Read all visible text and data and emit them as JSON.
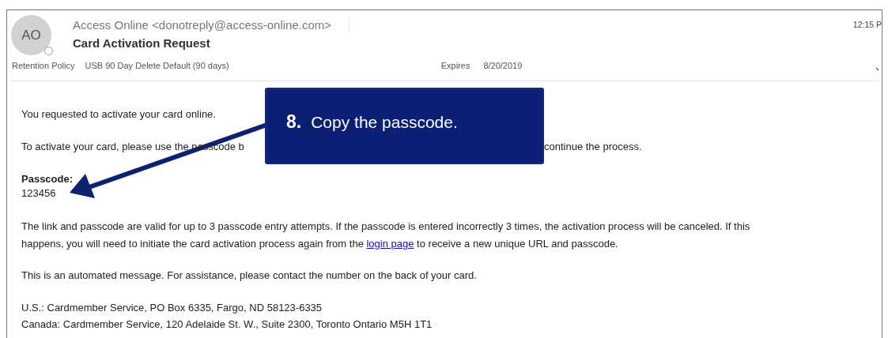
{
  "email": {
    "avatar_initials": "AO",
    "sender": "Access Online <donotreply@access-online.com>",
    "time": "12:15 P",
    "subject": "Card Activation Request",
    "retention_label": "Retention Policy",
    "retention_value": "USB 90 Day Delete Default (90 days)",
    "expires_label": "Expires",
    "expires_value": "8/20/2019"
  },
  "body": {
    "intro": "You requested to activate your card online.",
    "instruction_start": "To activate your card, please use the passcode b",
    "instruction_end": "continue the process.",
    "passcode_label": "Passcode:",
    "passcode": "123456",
    "validity_before_link": "The link and passcode are valid for up to 3 passcode entry attempts. If the passcode is entered incorrectly 3 times, the activation process will be canceled. If this happens, you will need to initiate the card activation process again from the",
    "link": "login page",
    "validity_after_link": "to receive a new unique URL and passcode.",
    "automated": "This is an automated message. For assistance, please contact the number on the back of your card.",
    "address_us": "U.S.: Cardmember Service, PO Box 6335, Fargo, ND 58123-6335",
    "address_canada": "Canada: Cardmember Service, 120 Adelaide St. W., Suite 2300, Toronto Ontario M5H 1T1"
  },
  "callout": {
    "step": "8.",
    "text": "Copy the passcode."
  }
}
